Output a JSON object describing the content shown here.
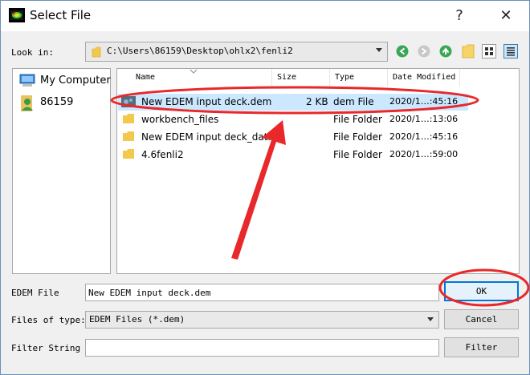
{
  "window": {
    "title": "Select File",
    "help_glyph": "?",
    "close_glyph": "✕"
  },
  "lookin": {
    "label": "Look in:",
    "path": "C:\\Users\\86159\\Desktop\\ohlx2\\fenli2"
  },
  "sidebar": {
    "items": [
      {
        "label": "My Computer",
        "icon": "computer-icon"
      },
      {
        "label": "86159",
        "icon": "user-icon"
      }
    ]
  },
  "filelist": {
    "columns": [
      "Name",
      "Size",
      "Type",
      "Date Modified"
    ],
    "rows": [
      {
        "name": "New EDEM input deck.dem",
        "size": "2 KB",
        "type": "dem File",
        "date": "2020/1…:45:16",
        "icon": "dem-file-icon",
        "selected": true
      },
      {
        "name": "workbench_files",
        "size": "",
        "type": "File Folder",
        "date": "2020/1…:13:06",
        "icon": "folder-icon"
      },
      {
        "name": "New EDEM input deck_data",
        "size": "",
        "type": "File Folder",
        "date": "2020/1…:45:16",
        "icon": "folder-icon"
      },
      {
        "name": "4.6fenli2",
        "size": "",
        "type": "File Folder",
        "date": "2020/1…:59:00",
        "icon": "folder-icon"
      }
    ]
  },
  "form": {
    "file_label": "EDEM File",
    "file_value": "New EDEM input deck.dem",
    "type_label": "Files of type:",
    "type_value": "EDEM Files (*.dem)",
    "filter_label": "Filter String",
    "filter_value": ""
  },
  "buttons": {
    "ok": "OK",
    "cancel": "Cancel",
    "filter": "Filter"
  },
  "colors": {
    "selection": "#cce8ff",
    "annotation": "#e8282a",
    "default_border": "#0078d7"
  }
}
